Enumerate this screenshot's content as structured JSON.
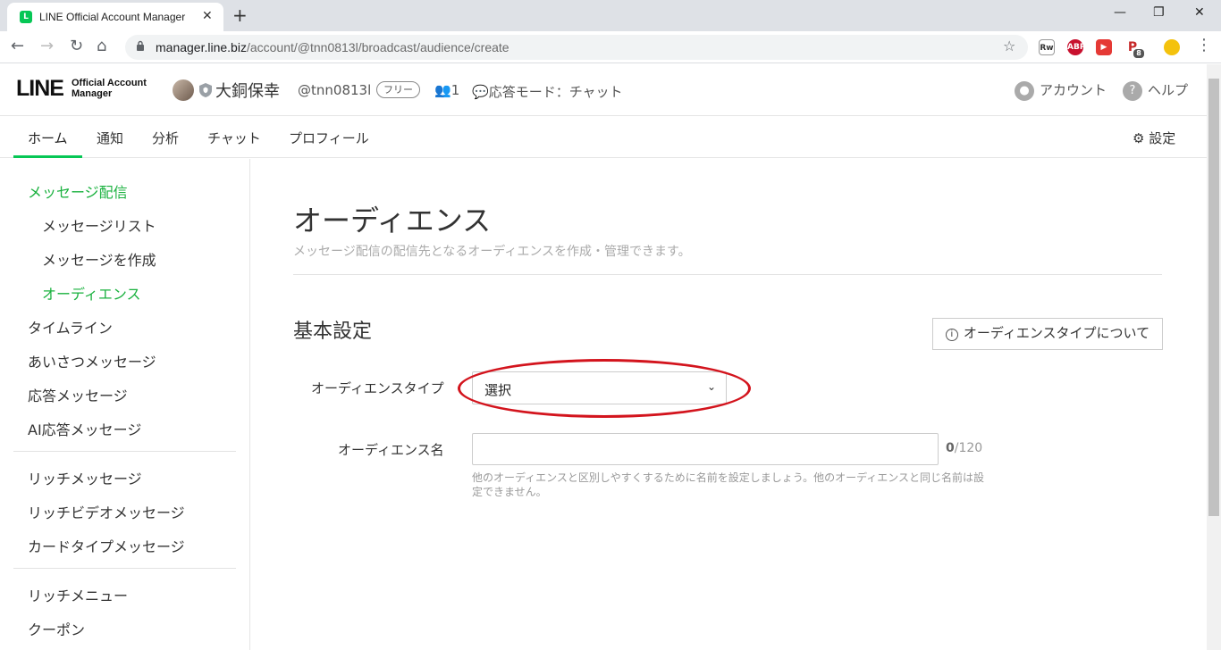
{
  "browser": {
    "tab_title": "LINE Official Account Manager",
    "tab_favicon": "L",
    "url_host": "manager.line.biz",
    "url_path": "/account/@tnn0813l/broadcast/audience/create",
    "ext_badge": "8"
  },
  "header": {
    "logo_main": "LINE",
    "logo_sub_1": "Official Account",
    "logo_sub_2": "Manager",
    "account_name": "大銅保幸",
    "account_id": "@tnn0813l",
    "plan_badge": "フリー",
    "friend_count": "1",
    "response_mode": "応答モード：チャット",
    "account_link": "アカウント",
    "help_link": "ヘルプ"
  },
  "nav": {
    "items": [
      "ホーム",
      "通知",
      "分析",
      "チャット",
      "プロフィール"
    ],
    "settings": "設定"
  },
  "sidebar": {
    "message_delivery": "メッセージ配信",
    "message_list": "メッセージリスト",
    "create_message": "メッセージを作成",
    "audience": "オーディエンス",
    "timeline": "タイムライン",
    "greeting": "あいさつメッセージ",
    "response": "応答メッセージ",
    "ai_response": "AI応答メッセージ",
    "rich_message": "リッチメッセージ",
    "rich_video": "リッチビデオメッセージ",
    "card_type": "カードタイプメッセージ",
    "rich_menu": "リッチメニュー",
    "coupon": "クーポン"
  },
  "main": {
    "title": "オーディエンス",
    "description": "メッセージ配信の配信先となるオーディエンスを作成・管理できます。",
    "section_title": "基本設定",
    "about_button": "オーディエンスタイプについて",
    "audience_type_label": "オーディエンスタイプ",
    "audience_type_value": "選択",
    "audience_name_label": "オーディエンス名",
    "audience_name_value": "",
    "counter_current": "0",
    "counter_max": "/120",
    "help_text": "他のオーディエンスと区別しやすくするために名前を設定しましょう。他のオーディエンスと同じ名前は設定できません。"
  },
  "colors": {
    "brand_green": "#06c755",
    "active_green": "#19b13e",
    "highlight_red": "#d3141d"
  }
}
